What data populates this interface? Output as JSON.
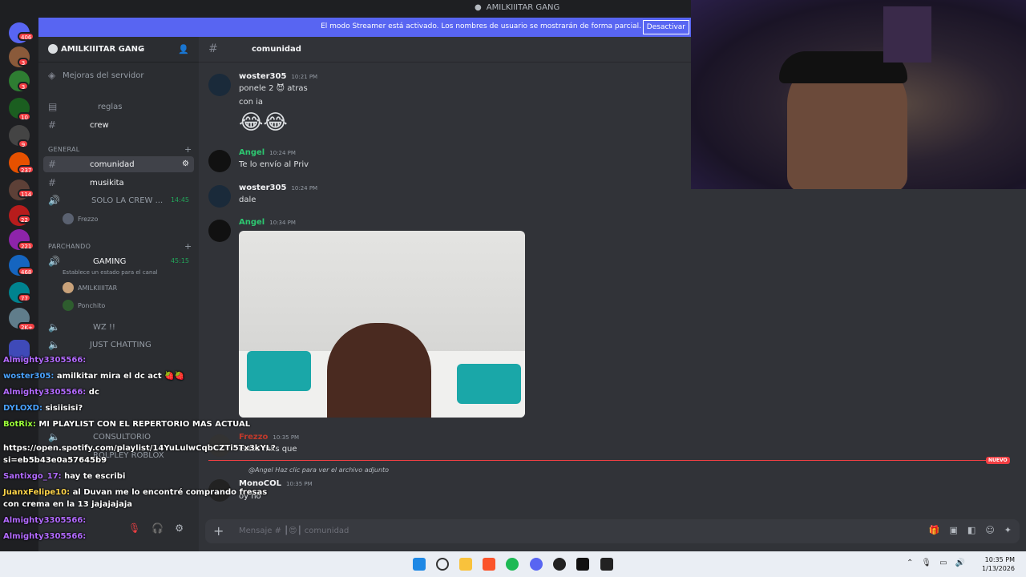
{
  "window": {
    "title": "AMILKIIITAR GANG"
  },
  "streamer_banner": {
    "message": "El modo Streamer está activado. Los nombres de usuario se mostrarán de forma parcial.",
    "button": "Desactivar"
  },
  "guild_badges": [
    "406",
    "3",
    "3",
    "10",
    "9",
    "237",
    "114",
    "22",
    "221",
    "468",
    "77",
    "2K+"
  ],
  "server": {
    "name": "AMILKIIITAR GANG",
    "boost_label": "Mejoras del servidor"
  },
  "channels": {
    "reglas": "reglas",
    "crew": "crew",
    "cat_general": "GENERAL",
    "comunidad": "comunidad",
    "musikita": "musikita",
    "solo_crew": "SOLO LA CREW ...",
    "solo_crew_time": "14:45",
    "frezzo": "Frezzo",
    "cat_parchando": "PARCHANDO",
    "gaming": "GAMING",
    "gaming_time": "45:15",
    "status_hint": "Establece un estado para el canal",
    "user_amilk": "AMILKIIIITAR",
    "user_ponchito": "Ponchito",
    "wz": "WZ !!",
    "just_chatting": "JUST CHATTING",
    "consultorio": "CONSULTORIO",
    "rolplay": "ROLPLEY ROBLOX"
  },
  "header": {
    "channel": "comunidad"
  },
  "messages": [
    {
      "user": "woster305",
      "time": "10:21 PM",
      "lines": [
        "ponele 2 😈 atras",
        "con ia",
        "😂😂"
      ]
    },
    {
      "user": "Angel",
      "time": "10:24 PM",
      "lines": [
        "Te lo envío al Priv"
      ]
    },
    {
      "user": "woster305",
      "time": "10:24 PM",
      "lines": [
        "dale"
      ]
    },
    {
      "user": "Angel",
      "time": "10:34 PM",
      "lines": []
    },
    {
      "user": "Frezzo",
      "time": "10:35 PM",
      "lines": [
        "estos mks que"
      ]
    },
    {
      "user": "MonoCOL",
      "time": "10:35 PM",
      "reply": "@Angel Haz clic para ver el archivo adjunto",
      "lines": [
        "oy no"
      ]
    }
  ],
  "new_marker": "NUEVO",
  "composer": {
    "placeholder": "Mensaje # ┃😍┃ comunidad"
  },
  "stream_chat": [
    {
      "user": "Almighty3305566:",
      "text": ""
    },
    {
      "user": "woster305:",
      "text": "amilkitar mira el dc act 🍓🍓"
    },
    {
      "user": "Almighty3305566:",
      "text": "dc"
    },
    {
      "user": "DYLOXD:",
      "text": "sisiisisi?"
    },
    {
      "user": "BotRix:",
      "text": "MI PLAYLIST CON EL REPERTORIO MAS ACTUAL"
    },
    {
      "user": "",
      "text": "https://open.spotify.com/playlist/14YuLulwCqbCZTi5Tx3kYL?"
    },
    {
      "user": "",
      "text": "si=eb5b43e0a57645b9"
    },
    {
      "user": "Santixgo_17:",
      "text": "hay te escribi"
    },
    {
      "user": "JuanxFelipe10:",
      "text": "al Duvan me lo encontré comprando fresas"
    },
    {
      "user": "",
      "text": "con crema en la 13 jajajajaja"
    },
    {
      "user": "Almighty3305566:",
      "text": ""
    },
    {
      "user": "Almighty3305566:",
      "text": ""
    }
  ],
  "taskbar": {
    "time": "10:35 PM",
    "date": "1/13/2026"
  }
}
